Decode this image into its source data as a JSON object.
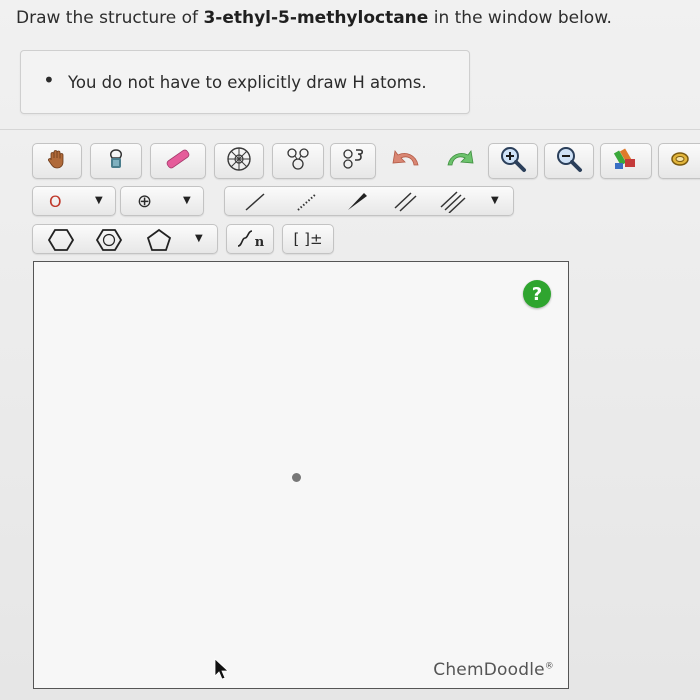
{
  "question": {
    "prefix": "Draw the structure of ",
    "compound": "3-ethyl-5-methyloctane",
    "suffix": " in the window below."
  },
  "hint": {
    "bullet": "•",
    "text": "You do not have to explicitly draw H atoms."
  },
  "toolbar": {
    "element_label": "O",
    "charge_symbol": "⊕",
    "caret": "▼",
    "chain_n": "n",
    "bracket_label": "[ ]±"
  },
  "canvas": {
    "help_label": "?",
    "brand": "ChemDoodle",
    "brand_mark": "®"
  },
  "colors": {
    "help_green": "#2fa52f",
    "element_red": "#c0392b",
    "canvas_border": "#555555"
  }
}
